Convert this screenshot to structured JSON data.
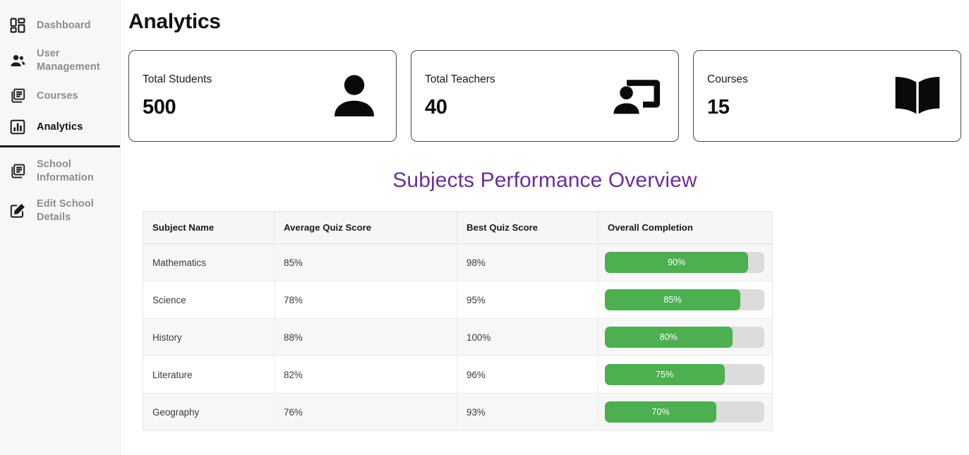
{
  "sidebar": {
    "items": [
      {
        "label": "Dashboard",
        "icon": "dashboard-grid-icon",
        "active": false,
        "divider_after": false
      },
      {
        "label": "User Management",
        "icon": "people-group-icon",
        "active": false,
        "divider_after": false
      },
      {
        "label": "Courses",
        "icon": "library-books-icon",
        "active": false,
        "divider_after": false
      },
      {
        "label": "Analytics",
        "icon": "insert-chart-icon",
        "active": true,
        "divider_after": true
      },
      {
        "label": "School Information",
        "icon": "library-books-icon",
        "active": false,
        "divider_after": false
      },
      {
        "label": "Edit School Details",
        "icon": "edit-square-icon",
        "active": false,
        "divider_after": false
      }
    ]
  },
  "header": {
    "title": "Analytics"
  },
  "cards": [
    {
      "label": "Total Students",
      "value": "500",
      "icon": "person-filled-icon"
    },
    {
      "label": "Total Teachers",
      "value": "40",
      "icon": "co-present-icon"
    },
    {
      "label": "Courses",
      "value": "15",
      "icon": "open-book-icon"
    }
  ],
  "table_section": {
    "title": "Subjects Performance Overview",
    "columns": [
      "Subject Name",
      "Average Quiz Score",
      "Best Quiz Score",
      "Overall Completion"
    ],
    "rows": [
      {
        "subject": "Mathematics",
        "average": "85%",
        "best": "98%",
        "completion_label": "90%",
        "completion_value": 90
      },
      {
        "subject": "Science",
        "average": "78%",
        "best": "95%",
        "completion_label": "85%",
        "completion_value": 85
      },
      {
        "subject": "History",
        "average": "88%",
        "best": "100%",
        "completion_label": "80%",
        "completion_value": 80
      },
      {
        "subject": "Literature",
        "average": "82%",
        "best": "96%",
        "completion_label": "75%",
        "completion_value": 75
      },
      {
        "subject": "Geography",
        "average": "76%",
        "best": "93%",
        "completion_label": "70%",
        "completion_value": 70
      }
    ]
  },
  "colors": {
    "section_title": "#6b2f9e",
    "progress_fill": "#4caf50",
    "progress_track": "#dcdcdc",
    "sidebar_bg": "#f7f7f7",
    "nav_inactive": "#8c8c8c",
    "nav_active": "#111111"
  }
}
